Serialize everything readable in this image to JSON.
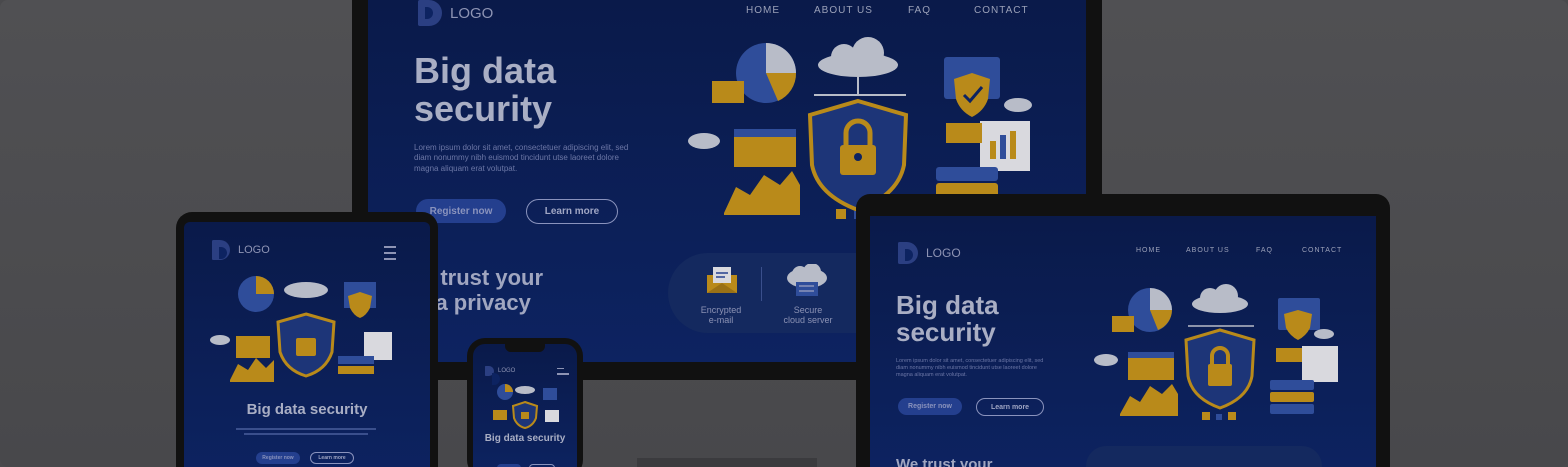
{
  "brand": {
    "logo_text": "LOGO"
  },
  "nav": {
    "home": "HOME",
    "about": "ABOUT US",
    "faq": "FAQ",
    "contact": "CONTACT"
  },
  "hero": {
    "title_line1": "Big data",
    "title_line2": "security",
    "title_single": "Big data security",
    "paragraph_line1": "Lorem ipsum dolor sit amet, consectetuer adipiscing elit, sed",
    "paragraph_line2": "diam nonummy nibh euismod tincidunt utse laoreet dolore",
    "paragraph_line3": "magna aliquam erat volutpat.",
    "register_label": "Register now",
    "learn_label": "Learn more"
  },
  "trust": {
    "line1_partial": "e trust your",
    "line2_partial": "ita privacy",
    "line1_laptop_partial": "We trust your"
  },
  "features": {
    "email_line1": "Encrypted",
    "email_line2": "e-mail",
    "server_line1": "Secure",
    "server_line2": "cloud server"
  },
  "colors": {
    "screen_bg": "#0d2361",
    "accent_orange": "#b98a1a",
    "accent_blue": "#2f4d9a",
    "overlay_gray": "#4a4a4d"
  }
}
